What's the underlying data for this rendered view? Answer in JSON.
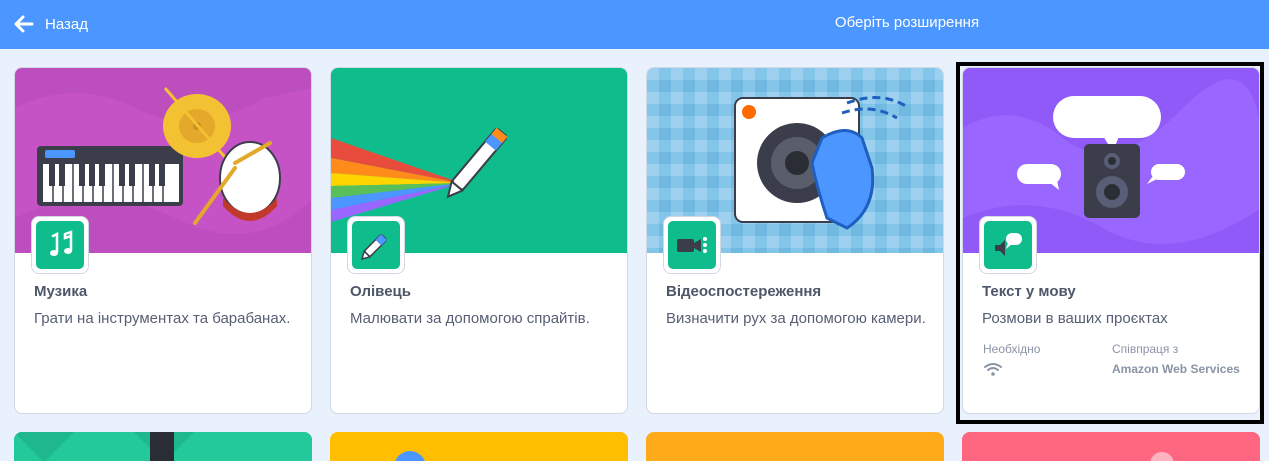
{
  "header": {
    "back_label": "Назад",
    "title": "Оберіть розширення",
    "color": "#4c97ff"
  },
  "extensions": [
    {
      "name": "Музика",
      "description": "Грати на інструментах та барабанах.",
      "icon": "music-notes-icon",
      "bg_color": "#c653c6"
    },
    {
      "name": "Олівець",
      "description": "Малювати за допомогою спрайтів.",
      "icon": "pen-icon",
      "bg_color": "#0fbd8c"
    },
    {
      "name": "Відеоспостереження",
      "description": "Визначити рух за допомогою камери.",
      "icon": "video-camera-icon",
      "bg_color": "#84c5ea"
    },
    {
      "name": "Текст у мову",
      "description": "Розмови в ваших проєктах",
      "icon": "speech-bubble-speaker-icon",
      "bg_color": "#9966ff",
      "requires_label": "Необхідно",
      "requires_icon": "wifi-icon",
      "collab_label": "Співпраця з",
      "collab_value": "Amazon Web Services",
      "selected": true
    }
  ],
  "next_row_colors": [
    "#24c99b",
    "#ffbf00",
    "#ffab19",
    "#ff6680"
  ]
}
